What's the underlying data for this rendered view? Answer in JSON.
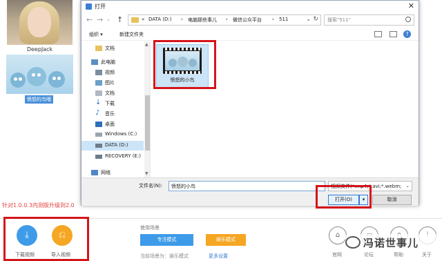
{
  "background_app": {
    "user_name": "DeepJack",
    "video_caption": "愤怒的鸟哦",
    "upgrade_notice": "针对1.0.0.3内测版升级到2.0",
    "bottom": {
      "download_label": "下载视频",
      "import_label": "导入视频",
      "scene_title": "使用场景",
      "focus_mode": "专注模式",
      "entertainment_mode": "娱乐模式",
      "current_scene": "当前场景为：娱乐模式",
      "more_settings": "更多设置",
      "nav": [
        {
          "label": "官网",
          "icon": "home-icon"
        },
        {
          "label": "论坛",
          "icon": "chat-icon"
        },
        {
          "label": "帮助",
          "icon": "headset-icon"
        },
        {
          "label": "关于",
          "icon": "info-icon"
        }
      ]
    },
    "watermark": "冯诺世事儿"
  },
  "dialog": {
    "title": "打开",
    "breadcrumbs": [
      "«",
      "DATA (D:)",
      "›",
      "电脑那些事儿",
      "›",
      "微信公众平台",
      "›",
      "511"
    ],
    "search_placeholder": "搜索\"511\"",
    "toolbar": {
      "organize": "组织 ▾",
      "new_folder": "新建文件夹",
      "help": "?"
    },
    "nav_items": [
      {
        "label": "文档",
        "icon": "folder-icon"
      },
      {
        "label": "此电脑",
        "icon": "computer-icon"
      },
      {
        "label": "视频",
        "icon": "video-folder-icon"
      },
      {
        "label": "图片",
        "icon": "pictures-folder-icon"
      },
      {
        "label": "文档",
        "icon": "documents-folder-icon"
      },
      {
        "label": "下载",
        "icon": "download-icon"
      },
      {
        "label": "音乐",
        "icon": "music-icon"
      },
      {
        "label": "桌面",
        "icon": "desktop-icon"
      },
      {
        "label": "Windows (C:)",
        "icon": "drive-icon"
      },
      {
        "label": "DATA (D:)",
        "icon": "drive-icon",
        "selected": true
      },
      {
        "label": "RECOVERY (E:)",
        "icon": "drive-icon"
      },
      {
        "label": "网络",
        "icon": "network-icon"
      }
    ],
    "files": [
      {
        "name": "愤怒的小鸟",
        "icon": "video-file-icon",
        "selected": true
      }
    ],
    "filename_label": "文件名(N):",
    "filename_value": "愤怒的小鸟",
    "file_type": "视频文件(*.mp4;*.avi;*.webm;",
    "open_button": "打开(O)",
    "cancel_button": "取消"
  },
  "colors": {
    "highlight_red": "#d4141a",
    "download_blue": "#3d9be9",
    "import_orange": "#f5a623",
    "focus_blue": "#3d9be9",
    "entertainment_orange": "#f5a623",
    "selection_blue": "#cce4f7"
  }
}
